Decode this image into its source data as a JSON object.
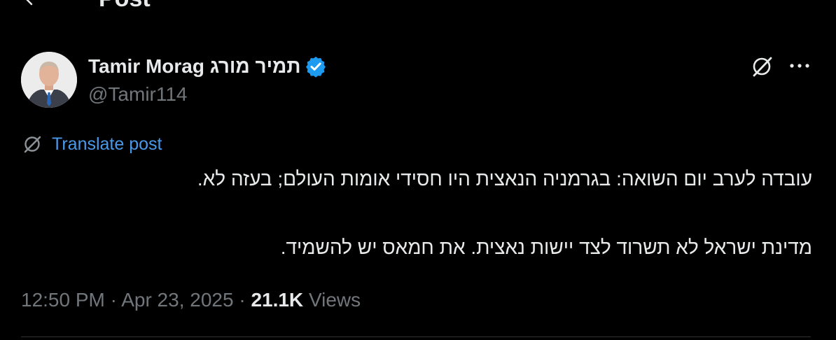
{
  "header": {
    "title": "Post",
    "back_icon": "arrow-left-icon"
  },
  "author": {
    "display_name": "Tamir Morag תמיר מורג",
    "handle": "@Tamir114",
    "verified_icon": "verified-badge-icon",
    "verified_color": "#1d9bf0",
    "avatar": "avatar-photo"
  },
  "actions": {
    "grok_icon": "grok-icon",
    "more_icon": "more-dots-icon"
  },
  "translate": {
    "label": "Translate post",
    "icon": "grok-icon",
    "color": "#4a99e9"
  },
  "post": {
    "line1": "עובדה לערב יום השואה: בגרמניה הנאצית היו חסידי אומות העולם; בעזה לא.",
    "line2": "מדינת ישראל לא תשרוד לצד יישות נאצית. את חמאס יש להשמיד."
  },
  "meta": {
    "time": "12:50 PM",
    "separator": "·",
    "date": "Apr 23, 2025",
    "views_count": "21.1K",
    "views_label": "Views"
  }
}
